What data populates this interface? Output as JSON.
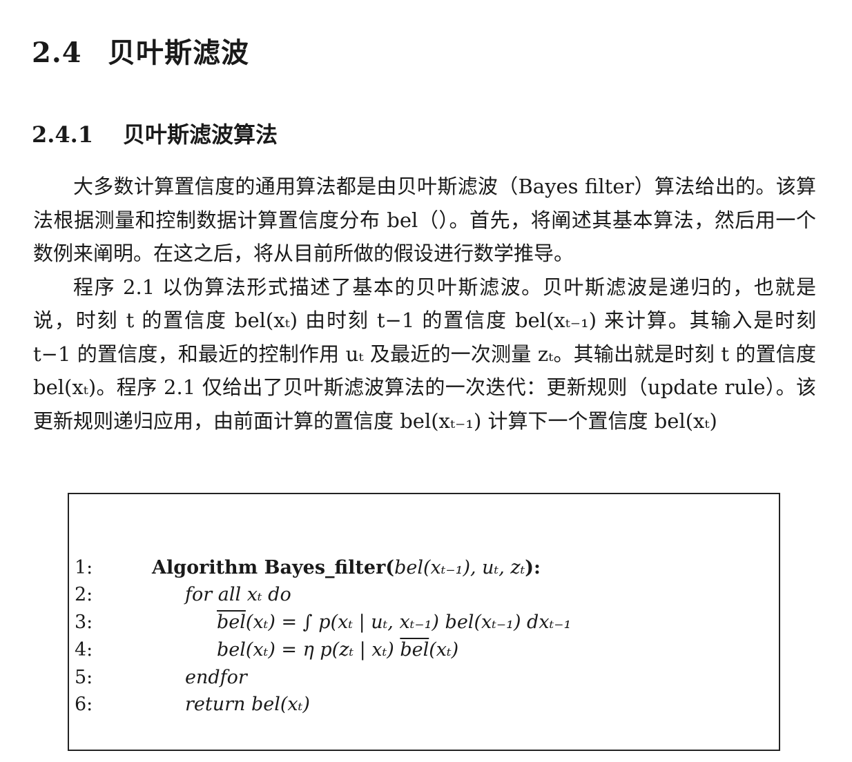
{
  "section": {
    "number": "2.4",
    "title": "贝叶斯滤波"
  },
  "subsection": {
    "number": "2.4.1",
    "title": "贝叶斯滤波算法"
  },
  "paragraphs": [
    "大多数计算置信度的通用算法都是由贝叶斯滤波（Bayes filter）算法给出的。该算法根据测量和控制数据计算置信度分布 bel（）。首先，将阐述其基本算法，然后用一个数例来阐明。在这之后，将从目前所做的假设进行数学推导。",
    "程序 2.1 以伪算法形式描述了基本的贝叶斯滤波。贝叶斯滤波是递归的，也就是说，时刻 t 的置信度 bel(xₜ) 由时刻 t−1 的置信度 bel(xₜ₋₁) 来计算。其输入是时刻 t−1 的置信度，和最近的控制作用 uₜ 及最近的一次测量 zₜ。其输出就是时刻 t 的置信度 bel(xₜ)。程序 2.1 仅给出了贝叶斯滤波算法的一次迭代：更新规则（update rule）。该更新规则递归应用，由前面计算的置信度 bel(xₜ₋₁) 计算下一个置信度 bel(xₜ)"
  ],
  "algorithm": {
    "line_numbers": [
      "1:",
      "2:",
      "3:",
      "4:",
      "5:",
      "6:"
    ],
    "header_keyword": "Algorithm Bayes_filter(",
    "header_args": "bel(xₜ₋₁), uₜ, zₜ",
    "header_close": "):",
    "line2": "for all xₜ do",
    "line3_bar": "bel",
    "line3_rest": "(xₜ) = ∫ p(xₜ | uₜ, xₜ₋₁) bel(xₜ₋₁) dxₜ₋₁",
    "line4_left": "bel(xₜ) = η p(zₜ | xₜ) ",
    "line4_bar": "bel",
    "line4_right": "(xₜ)",
    "line5": "endfor",
    "line6": "return bel(xₜ)"
  }
}
